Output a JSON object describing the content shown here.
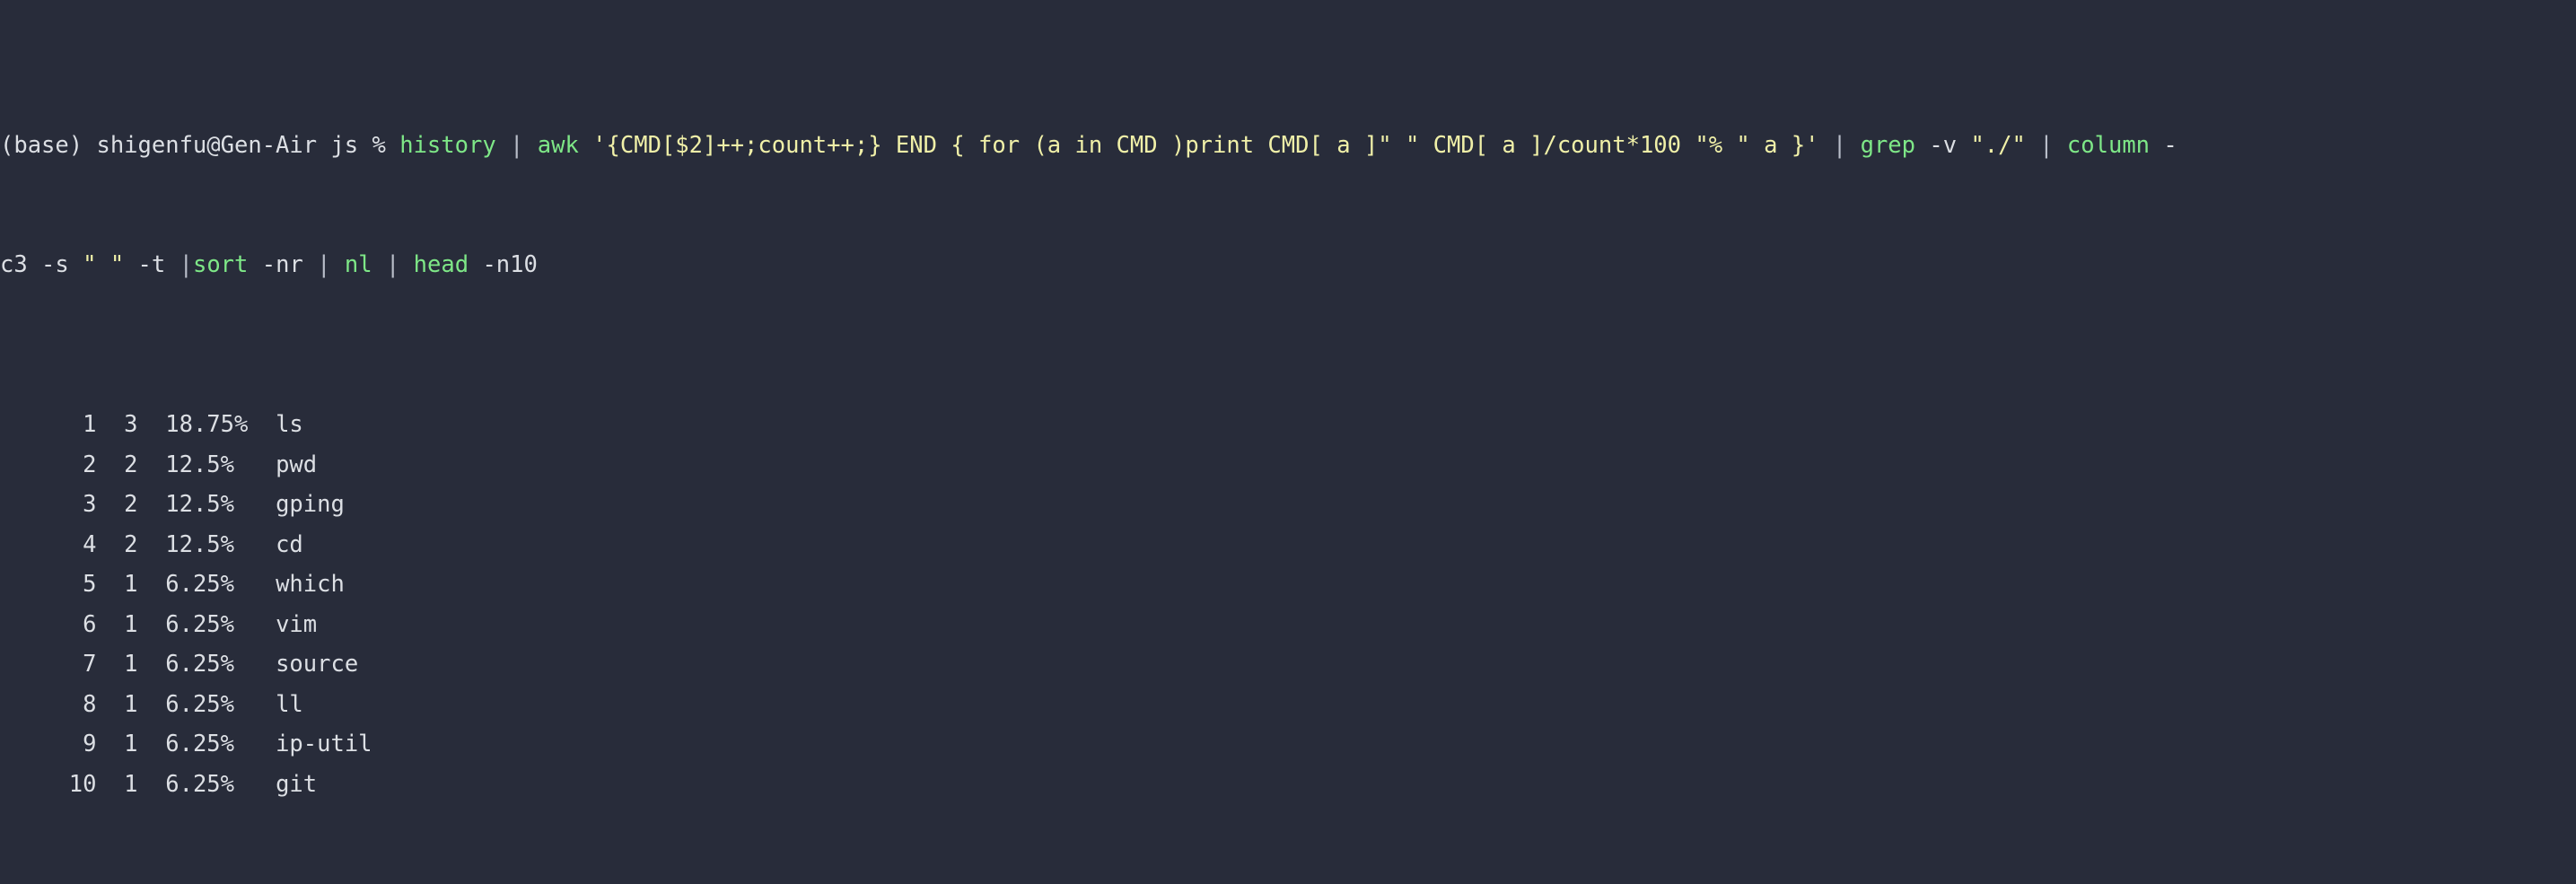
{
  "terminal": {
    "background_color": "#282c3a",
    "foreground_color": "#dcdfe4",
    "accent_green": "#7ee787",
    "accent_yellow": "#f0f0a8",
    "prompt": {
      "env": "(base)",
      "user_host": "shigenfu@Gen-Air",
      "cwd": "js",
      "symbol": "%"
    },
    "command_line_1": {
      "tokens": [
        {
          "text": "(base) shigenfu@Gen-Air js % ",
          "color": "white"
        },
        {
          "text": "history",
          "color": "green"
        },
        {
          "text": " | ",
          "color": "pipe"
        },
        {
          "text": "awk",
          "color": "green"
        },
        {
          "text": " ",
          "color": "white"
        },
        {
          "text": "'{CMD[$2]++;count++;} END { for (a in CMD )print CMD[ a ]\" \" CMD[ a ]/count*100 \"% \" a }'",
          "color": "yellow"
        },
        {
          "text": " | ",
          "color": "pipe"
        },
        {
          "text": "grep",
          "color": "green"
        },
        {
          "text": " -v ",
          "color": "white"
        },
        {
          "text": "\"./\"",
          "color": "yellow"
        },
        {
          "text": " | ",
          "color": "pipe"
        },
        {
          "text": "column",
          "color": "green"
        },
        {
          "text": " -",
          "color": "white"
        }
      ]
    },
    "command_line_2": {
      "tokens": [
        {
          "text": "c3 -s ",
          "color": "white"
        },
        {
          "text": "\" \"",
          "color": "yellow"
        },
        {
          "text": " -t ",
          "color": "white"
        },
        {
          "text": "|",
          "color": "pipe"
        },
        {
          "text": "sort",
          "color": "green"
        },
        {
          "text": " -nr ",
          "color": "white"
        },
        {
          "text": "| ",
          "color": "pipe"
        },
        {
          "text": "nl",
          "color": "green"
        },
        {
          "text": " ",
          "color": "white"
        },
        {
          "text": "| ",
          "color": "pipe"
        },
        {
          "text": "head",
          "color": "green"
        },
        {
          "text": " -n10",
          "color": "white"
        }
      ]
    },
    "full_command": "history | awk '{CMD[$2]++;count++;} END { for (a in CMD )print CMD[ a ]\" \" CMD[ a ]/count*100 \"% \" a }' | grep -v \"./\" | column -c3 -s \" \" -t |sort -nr | nl | head -n10",
    "output_rows": [
      {
        "rank": "1",
        "count": "3",
        "percent": "18.75%",
        "command": "ls"
      },
      {
        "rank": "2",
        "count": "2",
        "percent": "12.5%",
        "command": "pwd"
      },
      {
        "rank": "3",
        "count": "2",
        "percent": "12.5%",
        "command": "gping"
      },
      {
        "rank": "4",
        "count": "2",
        "percent": "12.5%",
        "command": "cd"
      },
      {
        "rank": "5",
        "count": "1",
        "percent": "6.25%",
        "command": "which"
      },
      {
        "rank": "6",
        "count": "1",
        "percent": "6.25%",
        "command": "vim"
      },
      {
        "rank": "7",
        "count": "1",
        "percent": "6.25%",
        "command": "source"
      },
      {
        "rank": "8",
        "count": "1",
        "percent": "6.25%",
        "command": "ll"
      },
      {
        "rank": "9",
        "count": "1",
        "percent": "6.25%",
        "command": "ip-util"
      },
      {
        "rank": "10",
        "count": "1",
        "percent": "6.25%",
        "command": "git"
      }
    ]
  }
}
